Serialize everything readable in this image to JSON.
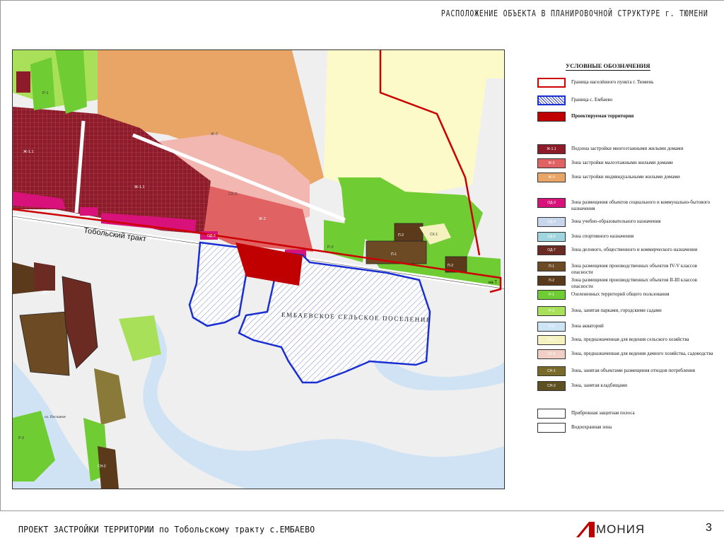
{
  "header": {
    "title": "РАСПОЛОЖЕНИЕ ОБЪЕКТА В ПЛАНИРОВОЧНОЙ СТРУКТУРЕ г. ТЮМЕНИ"
  },
  "map": {
    "road_label": "Тобольский тракт",
    "road_label_right": "на Т",
    "settlement_label": "ЕМБАЕВСКОЕ СЕЛЬСКОЕ ПОСЕЛЕНИЕ",
    "settlement_name_left": "оз. Песчаное",
    "zone_codes": {
      "residential_multi": "Ж-1.1",
      "residential_multi_2": "Ж-1.1",
      "residential_low": "Ж-2",
      "residential_low_2": "Ж-2",
      "residential_individual": "Ж-3",
      "residential_individual_2": "Ж-3",
      "park": "Р-1",
      "park_2": "Р-2",
      "social": "ОД-3",
      "business": "ОД-7",
      "production": "П-1",
      "production_2": "П-2",
      "production_3": "П-2",
      "agri": "СХ-1",
      "agri_2": "СХ-3",
      "water": "Р-3",
      "cemetery": "СН-2"
    }
  },
  "legend": {
    "title": "УСЛОВНЫЕ ОБОЗНАЧЕНИЯ",
    "items": [
      {
        "code": "",
        "label": "Граница населённого пункта г. Тюмень",
        "color": "#ffffff",
        "border": "#cc0000"
      },
      {
        "code": "",
        "label": "Граница с. Ембаево",
        "color": "#ffffff",
        "border": "#1a2fd1"
      },
      {
        "code": "",
        "label": "Проектируемая территория",
        "color": "#c00000",
        "border": "#333333"
      },
      {
        "code": "Ж-1.1",
        "label": "Подзона застройки многоэтажными жилыми домами",
        "color": "#8e1b2a",
        "border": "#333333"
      },
      {
        "code": "Ж-2",
        "label": "Зона застройки малоэтажными жилыми домами",
        "color": "#e06262",
        "border": "#333333"
      },
      {
        "code": "Ж-3",
        "label": "Зона застройки индивидуальными жилыми домами",
        "color": "#e9a566",
        "border": "#333333"
      },
      {
        "code": "ОД-3",
        "label": "Зона размещения объектов социального и коммунально-бытового назначения",
        "color": "#d8127a",
        "border": "#333333"
      },
      {
        "code": "ОД-4",
        "label": "Зона учебно-образовательного назначения",
        "color": "#c7d6ea",
        "border": "#333333"
      },
      {
        "code": "ОД-5",
        "label": "Зона спортивного назначения",
        "color": "#9fd5df",
        "border": "#333333"
      },
      {
        "code": "ОД-7",
        "label": "Зона делового, общественного и коммерческого назначения",
        "color": "#6b2a22",
        "border": "#333333"
      },
      {
        "code": "П-1",
        "label": "Зона размещения производственных объектов IV-V классов опасности",
        "color": "#6b4a24",
        "border": "#333333"
      },
      {
        "code": "П-2",
        "label": "Зона размещения производственных объектов II-III классов опасности",
        "color": "#5a3a1a",
        "border": "#333333"
      },
      {
        "code": "Р-1",
        "label": "Озелененных территорий общего пользования",
        "color": "#6fcc33",
        "border": "#333333"
      },
      {
        "code": "Р-2",
        "label": "Зона, занятая парками, городскими садами",
        "color": "#a8e05a",
        "border": "#333333"
      },
      {
        "code": "Р-3",
        "label": "Зона акваторий",
        "color": "#cde4f5",
        "border": "#333333"
      },
      {
        "code": "СХ-1",
        "label": "Зона, предназначенная для ведения сельского хозяйства",
        "color": "#f6f2c0",
        "border": "#333333"
      },
      {
        "code": "СХ-3",
        "label": "Зона, предназначенная для ведения дачного хозяйства, садоводства",
        "color": "#f2cfc4",
        "border": "#333333"
      },
      {
        "code": "СН-1",
        "label": "Зона, занятая объектами размещения отходов потребления",
        "color": "#7a6a2a",
        "border": "#333333"
      },
      {
        "code": "СН-2",
        "label": "Зона, занятая кладбищами",
        "color": "#5e5020",
        "border": "#333333"
      },
      {
        "code": "",
        "label": "Прибрежная защитная полоса",
        "color": "#ffffff",
        "border": "#333333"
      },
      {
        "code": "",
        "label": "Водоохранная зона",
        "color": "#ffffff",
        "border": "#333333"
      }
    ]
  },
  "footer": {
    "title": "ПРОЕКТ ЗАСТРОЙКИ ТЕРРИТОРИИ по Тобольскому тракту с.ЕМБАЕВО",
    "logo_prefix": "АР",
    "logo_text": "МОНИЯ",
    "page_number": "3"
  },
  "colors": {
    "boundary_red": "#cc0000",
    "boundary_blue": "#1a2fd1",
    "project_area": "#c00000",
    "water": "#cfe3f4",
    "background": "#efefef"
  }
}
